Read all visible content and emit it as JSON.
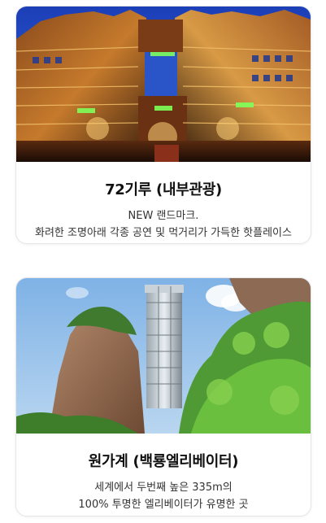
{
  "cards": [
    {
      "title": "72기루 (내부관광)",
      "desc_line1": "NEW 랜드마크.",
      "desc_line2": "화려한 조명아래 각종 공연 및 먹거리가 가득한 핫플레이스"
    },
    {
      "title": "원가계 (백룡엘리베이터)",
      "desc_line1": "세계에서 두번째 높은 335m의",
      "desc_line2": "100% 투명한 엘리베이터가 유명한 곳"
    }
  ]
}
